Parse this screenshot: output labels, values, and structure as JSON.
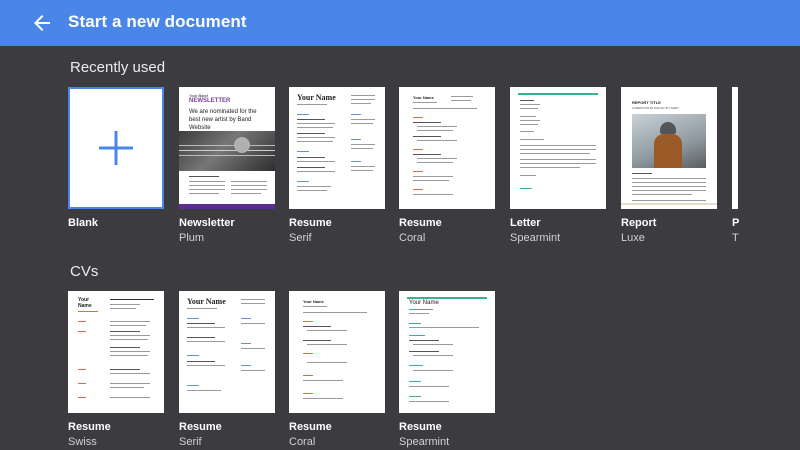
{
  "header": {
    "title": "Start a new document",
    "back_icon": "arrow-left-icon",
    "background": "#4a86e8"
  },
  "recent": {
    "heading": "Recently used",
    "templates": [
      {
        "name": "Blank",
        "sub": ""
      },
      {
        "name": "Newsletter",
        "sub": "Plum"
      },
      {
        "name": "Resume",
        "sub": "Serif"
      },
      {
        "name": "Resume",
        "sub": "Coral"
      },
      {
        "name": "Letter",
        "sub": "Spearmint"
      },
      {
        "name": "Report",
        "sub": "Luxe"
      },
      {
        "name": "P",
        "sub": "T"
      }
    ]
  },
  "cvs": {
    "heading": "CVs",
    "templates": [
      {
        "name": "Resume",
        "sub": "Swiss"
      },
      {
        "name": "Resume",
        "sub": "Serif"
      },
      {
        "name": "Resume",
        "sub": "Coral"
      },
      {
        "name": "Resume",
        "sub": "Spearmint"
      }
    ]
  },
  "thumbs": {
    "newsletter_kicker": "Your Band",
    "newsletter_head": "NEWSLETTER",
    "newsletter_title": "We are nominated for the best new artist by Band Website",
    "resume_name": "Your Name",
    "report_title": "REPORT TITLE",
    "report_sub": "LOREM IPSUM DOLOR SIT AMET",
    "swiss_name1": "Your",
    "swiss_name2": "Name"
  }
}
